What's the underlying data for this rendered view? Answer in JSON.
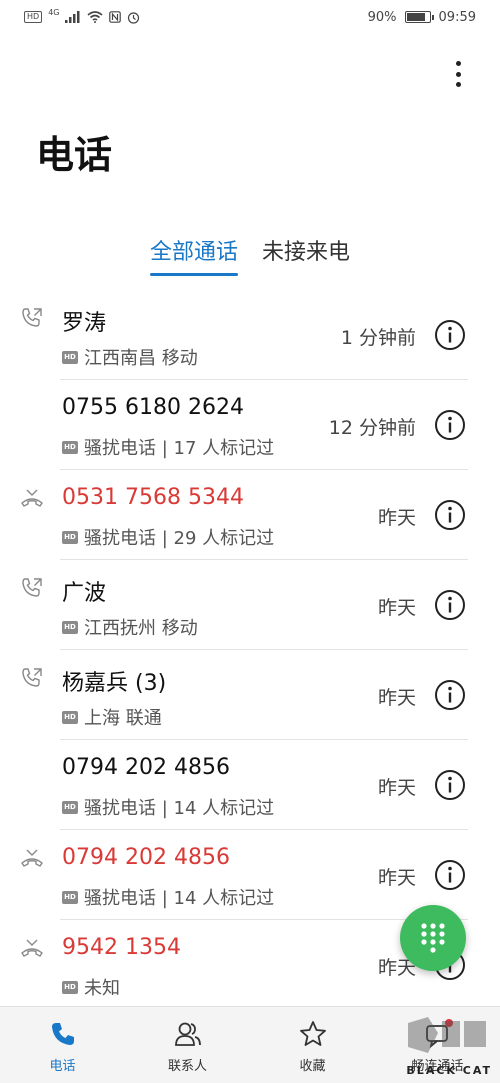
{
  "status_bar": {
    "network_badge": "HD",
    "network_type": "4G",
    "battery_percent": "90%",
    "battery_level": 0.9,
    "time": "09:59"
  },
  "header": {
    "title": "电话"
  },
  "tabs": [
    {
      "label": "全部通话",
      "active": true
    },
    {
      "label": "未接来电",
      "active": false
    }
  ],
  "calls": [
    {
      "name": "罗涛",
      "detail": "江西南昌 移动",
      "time": "1 分钟前",
      "type": "outgoing",
      "missed": false
    },
    {
      "name": "0755 6180 2624",
      "detail": "骚扰电话 | 17 人标记过",
      "time": "12 分钟前",
      "type": "incoming",
      "missed": false
    },
    {
      "name": "0531 7568 5344",
      "detail": "骚扰电话 | 29 人标记过",
      "time": "昨天",
      "type": "missed",
      "missed": true
    },
    {
      "name": "广波",
      "detail": "江西抚州 移动",
      "time": "昨天",
      "type": "outgoing",
      "missed": false
    },
    {
      "name": "杨嘉兵 (3)",
      "detail": "上海 联通",
      "time": "昨天",
      "type": "outgoing",
      "missed": false
    },
    {
      "name": "0794 202 4856",
      "detail": "骚扰电话 | 14 人标记过",
      "time": "昨天",
      "type": "incoming",
      "missed": false
    },
    {
      "name": "0794 202 4856",
      "detail": "骚扰电话 | 14 人标记过",
      "time": "昨天",
      "type": "missed",
      "missed": true
    },
    {
      "name": "9542 1354",
      "detail": "未知",
      "time": "昨天",
      "type": "missed",
      "missed": true
    }
  ],
  "hd_badge": "HD",
  "bottom_nav": [
    {
      "label": "电话",
      "icon": "phone-icon",
      "active": true
    },
    {
      "label": "联系人",
      "icon": "contacts-icon",
      "active": false
    },
    {
      "label": "收藏",
      "icon": "star-icon",
      "active": false
    },
    {
      "label": "畅连通话",
      "icon": "video-chat-icon",
      "active": false
    }
  ],
  "watermark": {
    "text": "BLACK CAT"
  },
  "colors": {
    "accent": "#1a78c8",
    "missed": "#d93a36",
    "fab": "#3dbb5e",
    "notification_dot": "#e0303a"
  }
}
